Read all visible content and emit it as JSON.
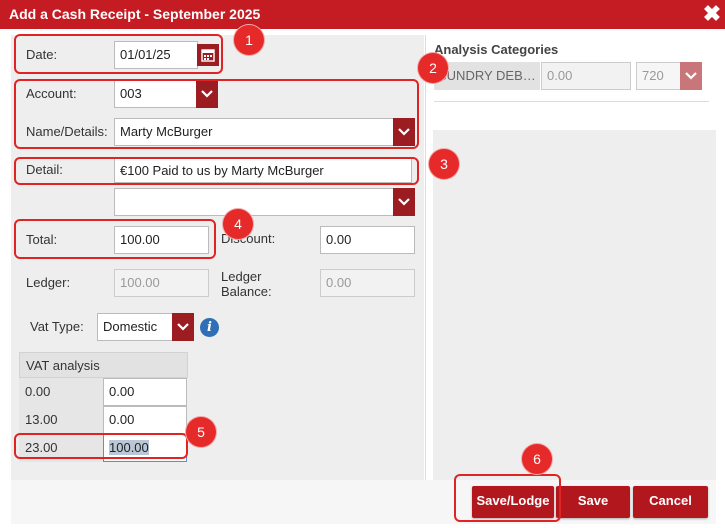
{
  "window": {
    "title": "Add a Cash Receipt - September 2025",
    "close_icon": "close-icon"
  },
  "form": {
    "date_label": "Date:",
    "date_value": "01/01/25",
    "account_label": "Account:",
    "account_value": "003",
    "name_label": "Name/Details:",
    "name_value": "Marty McBurger",
    "detail_label": "Detail:",
    "detail_value": "€100 Paid to us by Marty McBurger",
    "extra_select_value": "",
    "total_label": "Total:",
    "total_value": "100.00",
    "discount_label": "Discount:",
    "discount_value": "0.00",
    "ledger_label": "Ledger:",
    "ledger_value": "100.00",
    "ledger_balance_label_1": "Ledger",
    "ledger_balance_label_2": "Balance:",
    "ledger_balance_value": "0.00",
    "vat_type_label": "Vat Type:",
    "vat_type_value": "Domestic"
  },
  "vat_analysis": {
    "header": "VAT analysis",
    "rows": [
      {
        "rate": "0.00",
        "amount": "0.00"
      },
      {
        "rate": "13.00",
        "amount": "0.00"
      },
      {
        "rate": "23.00",
        "amount": "100.00"
      }
    ]
  },
  "analysis_categories": {
    "title": "Analysis Categories",
    "row": {
      "category": "SUNDRY DEB…",
      "amount": "0.00",
      "code": "720"
    }
  },
  "buttons": {
    "save_lodge": "Save/Lodge",
    "save": "Save",
    "cancel": "Cancel"
  },
  "callouts": [
    "1",
    "2",
    "3",
    "4",
    "5",
    "6"
  ],
  "colors": {
    "accent": "#c51b23",
    "button": "#b3171e",
    "callout": "#e02424",
    "panel": "#eeeeee"
  }
}
